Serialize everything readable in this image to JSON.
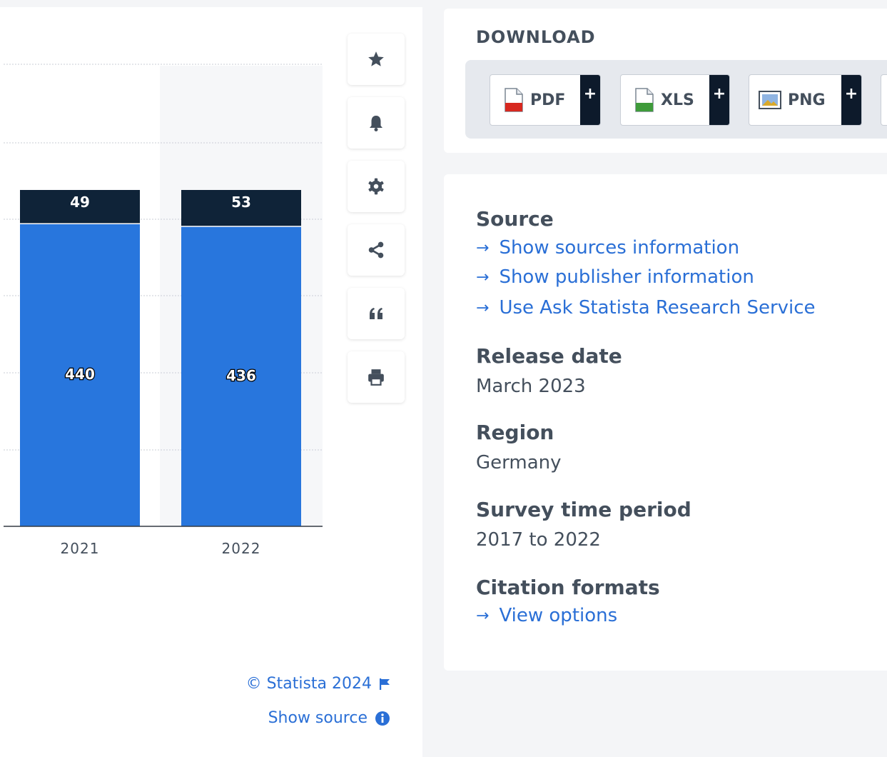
{
  "chart_data": {
    "type": "bar",
    "stacked": true,
    "categories": [
      "2021",
      "2022"
    ],
    "series": [
      {
        "values": [
          440,
          436
        ],
        "color": "#2876dd"
      },
      {
        "values": [
          49,
          53
        ],
        "color": "#0f2338"
      }
    ],
    "grid": true
  },
  "toolbar": {
    "items": [
      {
        "icon": "star-icon"
      },
      {
        "icon": "bell-icon"
      },
      {
        "icon": "gear-icon"
      },
      {
        "icon": "share-icon"
      },
      {
        "icon": "quote-icon"
      },
      {
        "icon": "print-icon"
      }
    ]
  },
  "credits": {
    "copyright": "© Statista 2024",
    "show_source": "Show source"
  },
  "download": {
    "title": "DOWNLOAD",
    "buttons": [
      {
        "label": "PDF",
        "plus": "+"
      },
      {
        "label": "XLS",
        "plus": "+"
      },
      {
        "label": "PNG",
        "plus": "+"
      }
    ]
  },
  "info": {
    "source_heading": "Source",
    "source_links": [
      "Show sources information",
      "Show publisher information",
      "Use Ask Statista Research Service"
    ],
    "release_heading": "Release date",
    "release_value": "March 2023",
    "region_heading": "Region",
    "region_value": "Germany",
    "period_heading": "Survey time period",
    "period_value": "2017 to 2022",
    "citation_heading": "Citation formats",
    "citation_link": "View options",
    "arrow": "→"
  }
}
